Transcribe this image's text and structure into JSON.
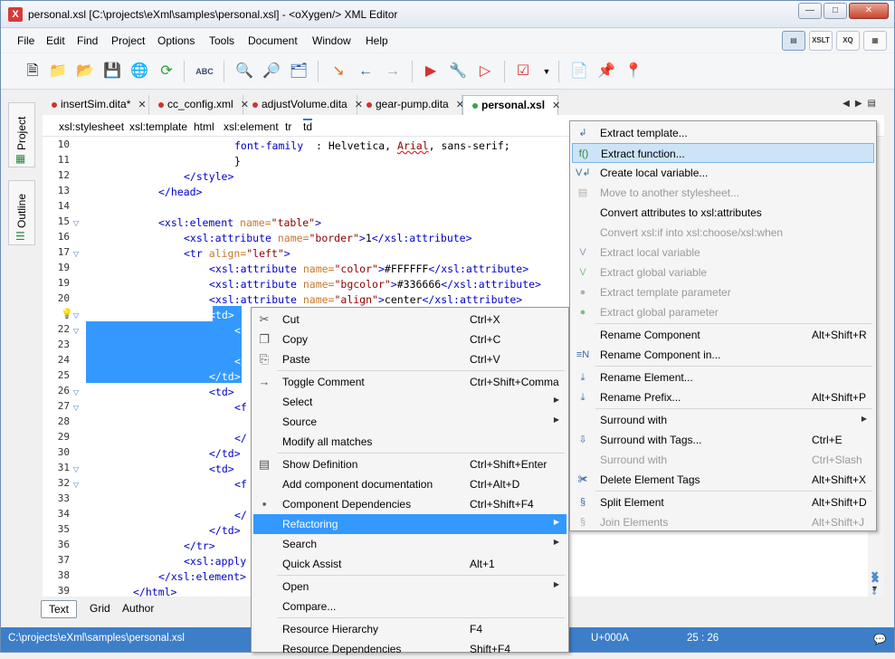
{
  "window": {
    "title": "personal.xsl [C:\\projects\\eXml\\samples\\personal.xsl] - <oXygen/> XML Editor",
    "app_icon": "oxygen-x-icon",
    "buttons": [
      "minimize-icon",
      "maximize-icon",
      "close-icon"
    ]
  },
  "menubar": {
    "items": [
      "File",
      "Edit",
      "Find",
      "Project",
      "Options",
      "Tools",
      "Document",
      "Window",
      "Help"
    ]
  },
  "perspectives": [
    "editor-perspective",
    "XSLT",
    "XQ",
    "database-perspective"
  ],
  "toolbar": {
    "icons": [
      "new-file-icon",
      "open-folder-icon",
      "open-url-icon",
      "save-icon",
      "web-icon",
      "refresh-icon",
      "spellcheck-icon",
      "find-icon",
      "find-file-icon",
      "import-icon",
      "back-icon",
      "forward-icon",
      "run-transform-icon",
      "configure-transform-icon",
      "debug-transform-icon",
      "validate-icon",
      "dropdown-icon",
      "xpath-icon",
      "pin-icon",
      "unpin-icon"
    ]
  },
  "side_tabs": [
    "Project",
    "Outline"
  ],
  "tabs": [
    {
      "label": "insertSim.dita*",
      "status": "modified"
    },
    {
      "label": "cc_config.xml",
      "status": "modified"
    },
    {
      "label": "adjustVolume.dita",
      "status": "modified"
    },
    {
      "label": "gear-pump.dita",
      "status": "modified"
    },
    {
      "label": "personal.xsl",
      "status": "active"
    }
  ],
  "breadcrumb": [
    "xsl:stylesheet",
    "xsl:template",
    "html",
    "xsl:element",
    "tr",
    "td"
  ],
  "editor": {
    "lines": [
      {
        "n": "10",
        "indent": 6,
        "parts": [
          [
            "cs",
            "font-family"
          ],
          [
            "",
            "  : Helvetica, "
          ],
          [
            "av",
            "Arial"
          ],
          [
            "",
            ", sans-serif;"
          ]
        ]
      },
      {
        "n": "11",
        "indent": 6,
        "parts": [
          [
            "",
            "}"
          ]
        ]
      },
      {
        "n": "12",
        "indent": 4,
        "parts": [
          [
            "tg",
            "</style>"
          ]
        ]
      },
      {
        "n": "13",
        "indent": 3,
        "parts": [
          [
            "tg",
            "</head>"
          ]
        ]
      },
      {
        "n": "14",
        "indent": 0,
        "parts": []
      },
      {
        "n": "15",
        "indent": 3,
        "parts": [
          [
            "tg",
            "<xsl:element "
          ],
          [
            "at",
            "name="
          ],
          [
            "av",
            "\"table\""
          ],
          [
            "tg",
            ">"
          ]
        ]
      },
      {
        "n": "16",
        "indent": 4,
        "parts": [
          [
            "tg",
            "<xsl:attribute "
          ],
          [
            "at",
            "name="
          ],
          [
            "av",
            "\"border\""
          ],
          [
            "tg",
            ">"
          ],
          [
            "",
            "1"
          ],
          [
            "tg",
            "</xsl:attribute>"
          ]
        ]
      },
      {
        "n": "17",
        "indent": 4,
        "parts": [
          [
            "tg",
            "<tr "
          ],
          [
            "at",
            "align="
          ],
          [
            "av",
            "\"left\""
          ],
          [
            "tg",
            ">"
          ]
        ]
      },
      {
        "n": "19",
        "indent": 5,
        "parts": [
          [
            "tg",
            "<xsl:attribute "
          ],
          [
            "at",
            "name="
          ],
          [
            "av",
            "\"color\""
          ],
          [
            "tg",
            ">"
          ],
          [
            "",
            "#FFFFFF"
          ],
          [
            "tg",
            "</xsl:attribute>"
          ]
        ]
      },
      {
        "n": "19",
        "indent": 5,
        "parts": [
          [
            "tg",
            "<xsl:attribute "
          ],
          [
            "at",
            "name="
          ],
          [
            "av",
            "\"bgcolor\""
          ],
          [
            "tg",
            ">"
          ],
          [
            "",
            "#336666"
          ],
          [
            "tg",
            "</xsl:attribute>"
          ]
        ]
      },
      {
        "n": "20",
        "indent": 5,
        "parts": [
          [
            "tg",
            "<xsl:attribute "
          ],
          [
            "at",
            "name="
          ],
          [
            "av",
            "\"align\""
          ],
          [
            "tg",
            ">"
          ],
          [
            "",
            "center"
          ],
          [
            "tg",
            "</xsl:attribute>"
          ]
        ]
      },
      {
        "n": "",
        "indent": 5,
        "parts": [
          [
            "tg",
            "<td>"
          ]
        ]
      },
      {
        "n": "22",
        "indent": 6,
        "parts": [
          [
            "tg",
            "<f"
          ]
        ]
      },
      {
        "n": "23",
        "indent": 0,
        "parts": []
      },
      {
        "n": "24",
        "indent": 6,
        "parts": [
          [
            "tg",
            "</"
          ]
        ]
      },
      {
        "n": "25",
        "indent": 5,
        "parts": [
          [
            "tg",
            "</td>"
          ]
        ]
      },
      {
        "n": "26",
        "indent": 5,
        "parts": [
          [
            "tg",
            "<td>"
          ]
        ]
      },
      {
        "n": "27",
        "indent": 6,
        "parts": [
          [
            "tg",
            "<f"
          ]
        ]
      },
      {
        "n": "28",
        "indent": 0,
        "parts": []
      },
      {
        "n": "29",
        "indent": 6,
        "parts": [
          [
            "tg",
            "</"
          ]
        ]
      },
      {
        "n": "30",
        "indent": 5,
        "parts": [
          [
            "tg",
            "</td>"
          ]
        ]
      },
      {
        "n": "31",
        "indent": 5,
        "parts": [
          [
            "tg",
            "<td>"
          ]
        ]
      },
      {
        "n": "32",
        "indent": 6,
        "parts": [
          [
            "tg",
            "<f"
          ]
        ]
      },
      {
        "n": "33",
        "indent": 0,
        "parts": []
      },
      {
        "n": "34",
        "indent": 6,
        "parts": [
          [
            "tg",
            "</"
          ]
        ]
      },
      {
        "n": "35",
        "indent": 5,
        "parts": [
          [
            "tg",
            "</td>"
          ]
        ]
      },
      {
        "n": "36",
        "indent": 4,
        "parts": [
          [
            "tg",
            "</tr>"
          ]
        ]
      },
      {
        "n": "37",
        "indent": 4,
        "parts": [
          [
            "tg",
            "<xsl:apply"
          ]
        ]
      },
      {
        "n": "38",
        "indent": 3,
        "parts": [
          [
            "tg",
            "</xsl:element>"
          ]
        ]
      },
      {
        "n": "39",
        "indent": 2,
        "parts": [
          [
            "tg",
            "</html>"
          ]
        ]
      }
    ],
    "bulb_icon": "lightbulb-icon"
  },
  "bottom_tabs": [
    "Text",
    "Grid",
    "Author"
  ],
  "status": {
    "path": "C:\\projects\\eXml\\samples\\personal.xsl",
    "unicode": "U+000A",
    "position": "25 : 26"
  },
  "context_menu": {
    "items": [
      {
        "icon": "scissors-icon",
        "label": "Cut",
        "shortcut": "Ctrl+X"
      },
      {
        "icon": "copy-icon",
        "label": "Copy",
        "shortcut": "Ctrl+C"
      },
      {
        "icon": "paste-icon",
        "label": "Paste",
        "shortcut": "Ctrl+V",
        "sep_after": true
      },
      {
        "icon": "comment-icon",
        "label": "Toggle Comment",
        "shortcut": "Ctrl+Shift+Comma"
      },
      {
        "icon": "",
        "label": "Select",
        "shortcut": "",
        "submenu": true
      },
      {
        "icon": "",
        "label": "Source",
        "shortcut": "",
        "submenu": true
      },
      {
        "icon": "",
        "label": "Modify all matches",
        "shortcut": "",
        "sep_after": true
      },
      {
        "icon": "definition-icon",
        "label": "Show Definition",
        "shortcut": "Ctrl+Shift+Enter"
      },
      {
        "icon": "",
        "label": "Add component documentation",
        "shortcut": "Ctrl+Alt+D"
      },
      {
        "icon": "dependencies-icon",
        "label": "Component Dependencies",
        "shortcut": "Ctrl+Shift+F4"
      },
      {
        "icon": "",
        "label": "Refactoring",
        "shortcut": "",
        "submenu": true,
        "highlight": true
      },
      {
        "icon": "",
        "label": "Search",
        "shortcut": "",
        "submenu": true
      },
      {
        "icon": "",
        "label": "Quick Assist",
        "shortcut": "Alt+1",
        "sep_after": true
      },
      {
        "icon": "",
        "label": "Open",
        "shortcut": "",
        "submenu": true
      },
      {
        "icon": "",
        "label": "Compare...",
        "shortcut": "",
        "sep_after": true
      },
      {
        "icon": "",
        "label": "Resource Hierarchy",
        "shortcut": "F4"
      },
      {
        "icon": "",
        "label": "Resource Dependencies",
        "shortcut": "Shift+F4"
      }
    ]
  },
  "submenu": {
    "items": [
      {
        "icon": "extract-template-icon",
        "label": "Extract template...",
        "shortcut": ""
      },
      {
        "icon": "extract-function-icon",
        "label": "Extract function...",
        "shortcut": "",
        "highlight": true
      },
      {
        "icon": "create-variable-icon",
        "label": "Create local variable...",
        "shortcut": ""
      },
      {
        "icon": "move-icon",
        "label": "Move to another stylesheet...",
        "shortcut": "",
        "disabled": true
      },
      {
        "icon": "",
        "label": "Convert attributes to xsl:attributes",
        "shortcut": ""
      },
      {
        "icon": "",
        "label": "Convert xsl:if into xsl:choose/xsl:when",
        "shortcut": "",
        "disabled": true
      },
      {
        "icon": "variable-icon",
        "label": "Extract local variable",
        "shortcut": "",
        "disabled": true
      },
      {
        "icon": "global-variable-icon",
        "label": "Extract global variable",
        "shortcut": "",
        "disabled": true
      },
      {
        "icon": "parameter-icon",
        "label": "Extract template parameter",
        "shortcut": "",
        "disabled": true
      },
      {
        "icon": "global-parameter-icon",
        "label": "Extract global parameter",
        "shortcut": "",
        "disabled": true,
        "sep_after": true
      },
      {
        "icon": "",
        "label": "Rename Component",
        "shortcut": "Alt+Shift+R"
      },
      {
        "icon": "rename-in-icon",
        "label": "Rename Component in...",
        "shortcut": "",
        "sep_after": true
      },
      {
        "icon": "rename-element-icon",
        "label": "Rename Element...",
        "shortcut": ""
      },
      {
        "icon": "rename-prefix-icon",
        "label": "Rename Prefix...",
        "shortcut": "Alt+Shift+P",
        "sep_after": true
      },
      {
        "icon": "",
        "label": "Surround with",
        "shortcut": "",
        "submenu": true
      },
      {
        "icon": "surround-tags-icon",
        "label": "Surround with Tags...",
        "shortcut": "Ctrl+E"
      },
      {
        "icon": "",
        "label": "Surround with",
        "shortcut": "Ctrl+Slash",
        "disabled": true
      },
      {
        "icon": "delete-tags-icon",
        "label": "Delete Element Tags",
        "shortcut": "Alt+Shift+X",
        "sep_after": true
      },
      {
        "icon": "split-icon",
        "label": "Split Element",
        "shortcut": "Alt+Shift+D"
      },
      {
        "icon": "join-icon",
        "label": "Join Elements",
        "shortcut": "Alt+Shift+J",
        "disabled": true
      }
    ]
  }
}
